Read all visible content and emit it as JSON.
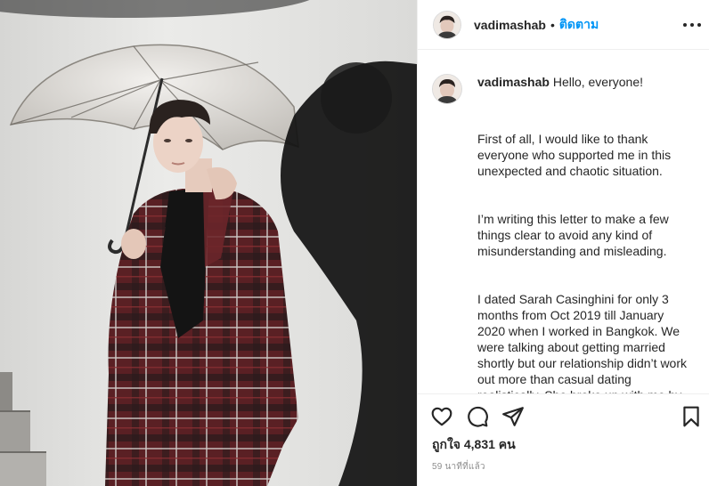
{
  "post": {
    "username": "vadimashab",
    "separator": "•",
    "follow_label": "ติดตาม",
    "more_icon": "more-options-icon"
  },
  "caption": {
    "username": "vadimashab",
    "greeting": "Hello, everyone!",
    "paragraphs": [
      "First of all, I would like to thank everyone who supported me in this unexpected and chaotic situation.",
      "I’m writing this letter to make a few things clear to avoid any kind of misunderstanding and misleading.",
      "I dated Sarah Casinghini for only 3 months from Oct 2019 till January 2020 when I worked in Bangkok. We were talking about getting married shortly but our relationship didn’t work out more than casual dating realistically. She broke up with me by"
    ]
  },
  "actions": {
    "like_icon": "heart-icon",
    "comment_icon": "comment-icon",
    "share_icon": "share-icon",
    "save_icon": "bookmark-icon"
  },
  "likes_text": "ถูกใจ 4,831 คน",
  "timestamp": "59 นาทีที่แล้ว",
  "colors": {
    "link": "#0095f6",
    "text": "#262626",
    "muted": "#8e8e8e",
    "border": "#efefef"
  }
}
